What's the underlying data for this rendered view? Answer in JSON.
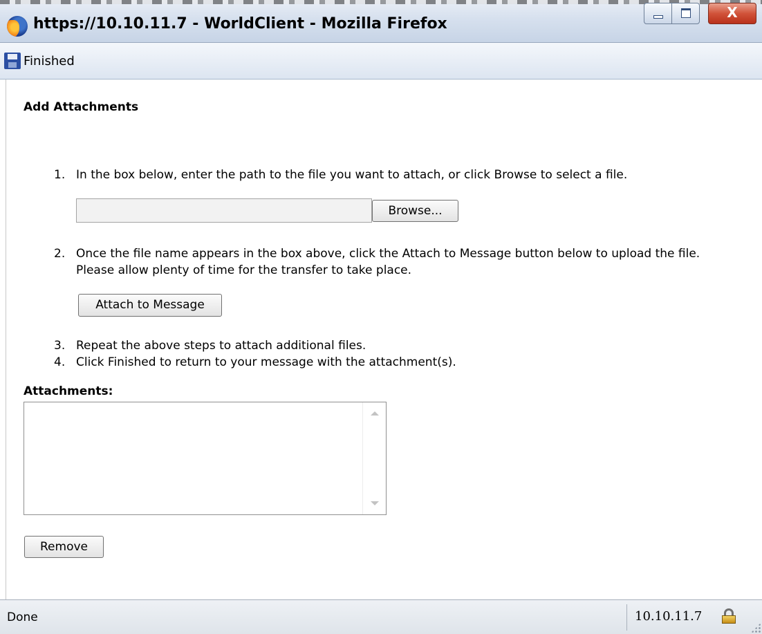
{
  "window": {
    "title": "https://10.10.11.7 - WorldClient - Mozilla Firefox",
    "buttons": {
      "close_label": "X"
    }
  },
  "toolbar": {
    "finished_label": "Finished",
    "finished_icon": "save-icon"
  },
  "main": {
    "page_title": "Add Attachments",
    "steps": [
      {
        "num": "1.",
        "text": "In the box below, enter the path to the file you want to attach, or click Browse to select a file."
      },
      {
        "num": "2.",
        "text": "Once the file name appears in the box above, click the Attach to Message button below to upload the file.",
        "text2": "Please allow plenty of time for the transfer to take place."
      },
      {
        "num": "3.",
        "text": "Repeat the above steps to attach additional files."
      },
      {
        "num": "4.",
        "text": "Click Finished to return to your message with the attachment(s)."
      }
    ],
    "file_input": {
      "value": "",
      "placeholder": ""
    },
    "browse_label": "Browse...",
    "attach_label": "Attach to Message",
    "attachments_label": "Attachments:",
    "attachments_items": [],
    "remove_label": "Remove"
  },
  "statusbar": {
    "status": "Done",
    "host": "10.10.11.7",
    "icon": "lock-icon"
  },
  "colors": {
    "titlebar": "#d6e0ee",
    "close_button": "#d1533a",
    "toolbar": "#dce5f1",
    "statusbar": "#dfe4ea"
  }
}
